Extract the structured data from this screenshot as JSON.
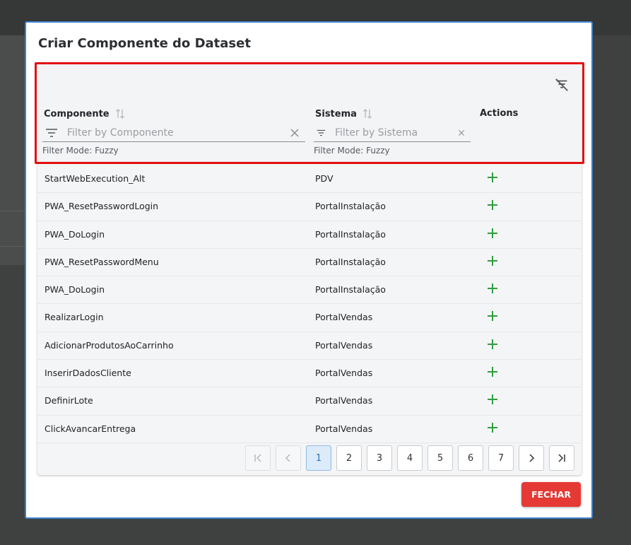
{
  "dialog": {
    "title": "Criar Componente do Dataset",
    "close_label": "FECHAR"
  },
  "table": {
    "columns": [
      {
        "label": "Componente",
        "placeholder": "Filter by Componente",
        "filter_mode": "Filter Mode: Fuzzy"
      },
      {
        "label": "Sistema",
        "placeholder": "Filter by Sistema",
        "filter_mode": "Filter Mode: Fuzzy"
      },
      {
        "label": "Actions"
      }
    ],
    "rows": [
      {
        "componente": "StartWebExecution_Alt",
        "sistema": "PDV"
      },
      {
        "componente": "PWA_ResetPasswordLogin",
        "sistema": "PortalInstalação"
      },
      {
        "componente": "PWA_DoLogin",
        "sistema": "PortalInstalação"
      },
      {
        "componente": "PWA_ResetPasswordMenu",
        "sistema": "PortalInstalação"
      },
      {
        "componente": "PWA_DoLogin",
        "sistema": "PortalInstalação"
      },
      {
        "componente": "RealizarLogin",
        "sistema": "PortalVendas"
      },
      {
        "componente": "AdicionarProdutosAoCarrinho",
        "sistema": "PortalVendas"
      },
      {
        "componente": "InserirDadosCliente",
        "sistema": "PortalVendas"
      },
      {
        "componente": "DefinirLote",
        "sistema": "PortalVendas"
      },
      {
        "componente": "ClickAvancarEntrega",
        "sistema": "PortalVendas"
      }
    ]
  },
  "pagination": {
    "pages": [
      "1",
      "2",
      "3",
      "4",
      "5",
      "6",
      "7"
    ],
    "current_page": "1"
  },
  "colors": {
    "accent_blue": "#3c82c8",
    "highlight_red": "#e10f0f",
    "add_green": "#2e9e3f",
    "close_button": "#e53935"
  }
}
